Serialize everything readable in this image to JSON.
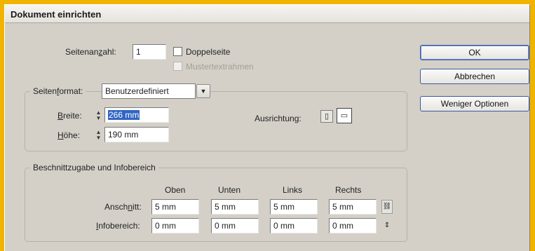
{
  "dialog": {
    "title": "Dokument einrichten"
  },
  "pages": {
    "label": "Seitenanzahl:",
    "value": "1"
  },
  "facing_pages": {
    "label": "Doppelseite",
    "checked": false
  },
  "master_text_frame": {
    "label": "Mustertextrahmen",
    "checked": false,
    "disabled": true
  },
  "page_size": {
    "label": "Seitenformat:",
    "selected": "Benutzerdefiniert"
  },
  "width": {
    "label": "Breite:",
    "value": "266 mm"
  },
  "height": {
    "label": "Höhe:",
    "value": "190 mm"
  },
  "orientation": {
    "label": "Ausrichtung:",
    "options": [
      "portrait-icon",
      "landscape-icon"
    ],
    "selected": "landscape-icon"
  },
  "buttons": {
    "ok": "OK",
    "cancel": "Abbrechen",
    "fewer_options": "Weniger Optionen"
  },
  "bleed_slug": {
    "title": "Beschnittzugabe und Infobereich",
    "columns": [
      "Oben",
      "Unten",
      "Links",
      "Rechts"
    ],
    "bleed": {
      "label": "Anschnitt:",
      "values": [
        "5 mm",
        "5 mm",
        "5 mm",
        "5 mm"
      ]
    },
    "slug": {
      "label": "Infobereich:",
      "values": [
        "0 mm",
        "0 mm",
        "0 mm",
        "0 mm"
      ]
    }
  },
  "colors": {
    "accent": "#3b5b9c",
    "background": "#d4d0c8",
    "frame": "#f0b400"
  }
}
